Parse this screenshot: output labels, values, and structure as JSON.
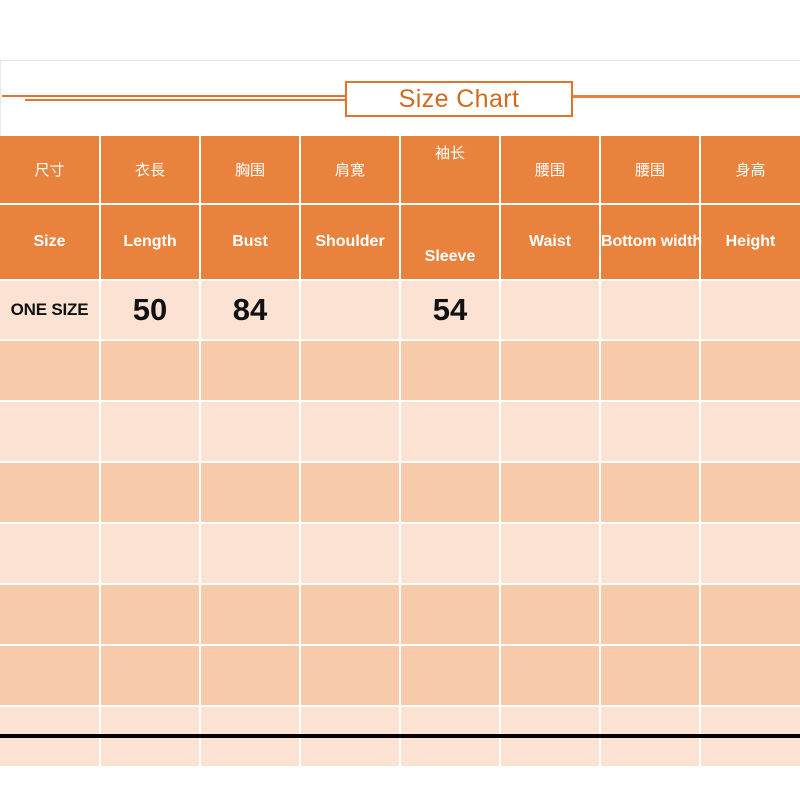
{
  "title": {
    "text": "Size Chart"
  },
  "colors": {
    "header_orange": "#e8823c",
    "title_orange": "#d2691e",
    "rule_orange": "#e2752c",
    "row_light": "#fbe2d3",
    "row_dark": "#f7cbaa",
    "grid_white": "#ffffff",
    "bottom_rule": "#000000",
    "value_text": "#111111"
  },
  "table": {
    "headers_cn": [
      "尺寸",
      "衣長",
      "胸围",
      "肩寛",
      "袖长",
      "腰围",
      "腰围",
      "身高"
    ],
    "headers_en": [
      "Size",
      "Length",
      "Bust",
      "Shoulder",
      "Sleeve",
      "Waist",
      "Bottom width",
      "Height"
    ],
    "rows": [
      {
        "size": "ONE SIZE",
        "length": "50",
        "bust": "84",
        "shoulder": "",
        "sleeve": "54",
        "waist": "",
        "bottom_width": "",
        "height": ""
      }
    ],
    "empty_rows": 7
  }
}
